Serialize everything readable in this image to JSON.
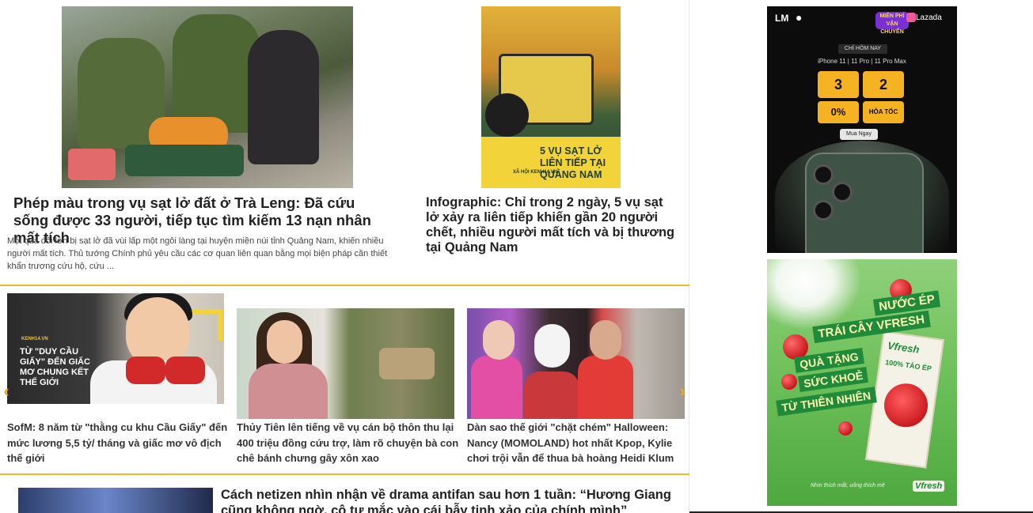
{
  "featured_left": {
    "title": "Phép màu trong vụ sạt lở đất ở Trà Leng: Đã cứu sống được 33 người, tiếp tục tìm kiếm 13 nạn nhân mất tích",
    "sapo": "Một quả đồi lớn bị sạt lở đã vùi lấp một ngôi làng tại huyện miền núi tỉnh Quảng Nam, khiến nhiều người mất tích. Thủ tướng Chính phủ yêu cầu các cơ quan liên quan bằng mọi biện pháp cần thiết khẩn trương cứu hộ, cứu ..."
  },
  "featured_right": {
    "title": "Infographic: Chỉ trong 2 ngày, 5 vụ sạt lở xảy ra liên tiếp khiến gần 20 người chết, nhiều người mất tích và bị thương tại Quảng Nam",
    "image_caption": "5 VỤ SẠT LỞ LIÊN TIẾP TẠI QUẢNG NAM",
    "image_source": "XÃ HỘI KENH14.VN"
  },
  "carousel": {
    "prev_icon": "‹",
    "next_icon": "›",
    "items": [
      {
        "title": "SofM: 8 năm từ \"thằng cu khu Cầu Giấy\" đến mức lương 5,5 tỷ/ tháng và giấc mơ vô địch thế giới",
        "image_tag": "KENH14.VN",
        "image_text": "TỪ \"DUY CẦU GIẤY\" ĐẾN GIẤC MƠ CHUNG KẾT THẾ GIỚI"
      },
      {
        "title": "Thủy Tiên lên tiếng về vụ cán bộ thôn thu lại 400 triệu đồng cứu trợ, làm rõ chuyện bà con chê bánh chưng gây xôn xao"
      },
      {
        "title": "Dàn sao thế giới \"chặt chém\" Halloween: Nancy (MOMOLAND) hot nhất Kpop, Kylie chơi trội vẫn để thua bà hoàng Heidi Klum"
      }
    ]
  },
  "bottom_item": {
    "title": "Cách netizen nhìn nhận về drama antifan sau hơn 1 tuần: “Hương Giang cũng không ngờ, cô tự mắc vào cái bẫy tinh xảo của chính mình”"
  },
  "ads": {
    "ad1": {
      "brand_left": "LM",
      "brand_right": "Lazada",
      "badge": "MIỄN PHÍ VẬN CHUYỂN",
      "headline": "CHỈ HÔM NAY",
      "models": "iPhone 11 | 11 Pro | 11 Pro Max",
      "tile1": "3",
      "tile2": "2",
      "tile3": "0%",
      "tile4": "HỎA TỐC",
      "cta": "Mua Ngay"
    },
    "ad2": {
      "line1": "NƯỚC ÉP",
      "line2": "TRÁI CÂY VFRESH",
      "line3": "QUÀ TẶNG",
      "line4": "SỨC KHOẺ",
      "line5": "TỪ THIÊN NHIÊN",
      "pack_brand": "Vfresh",
      "pack_sub": "100% TÁO ÉP",
      "tagline": "Nhìn thích mắt, uống thích mê",
      "logo": "Vfresh"
    }
  },
  "colors": {
    "divider": "#f0b72f",
    "arrow": "#f0a81c",
    "title": "#222222"
  }
}
